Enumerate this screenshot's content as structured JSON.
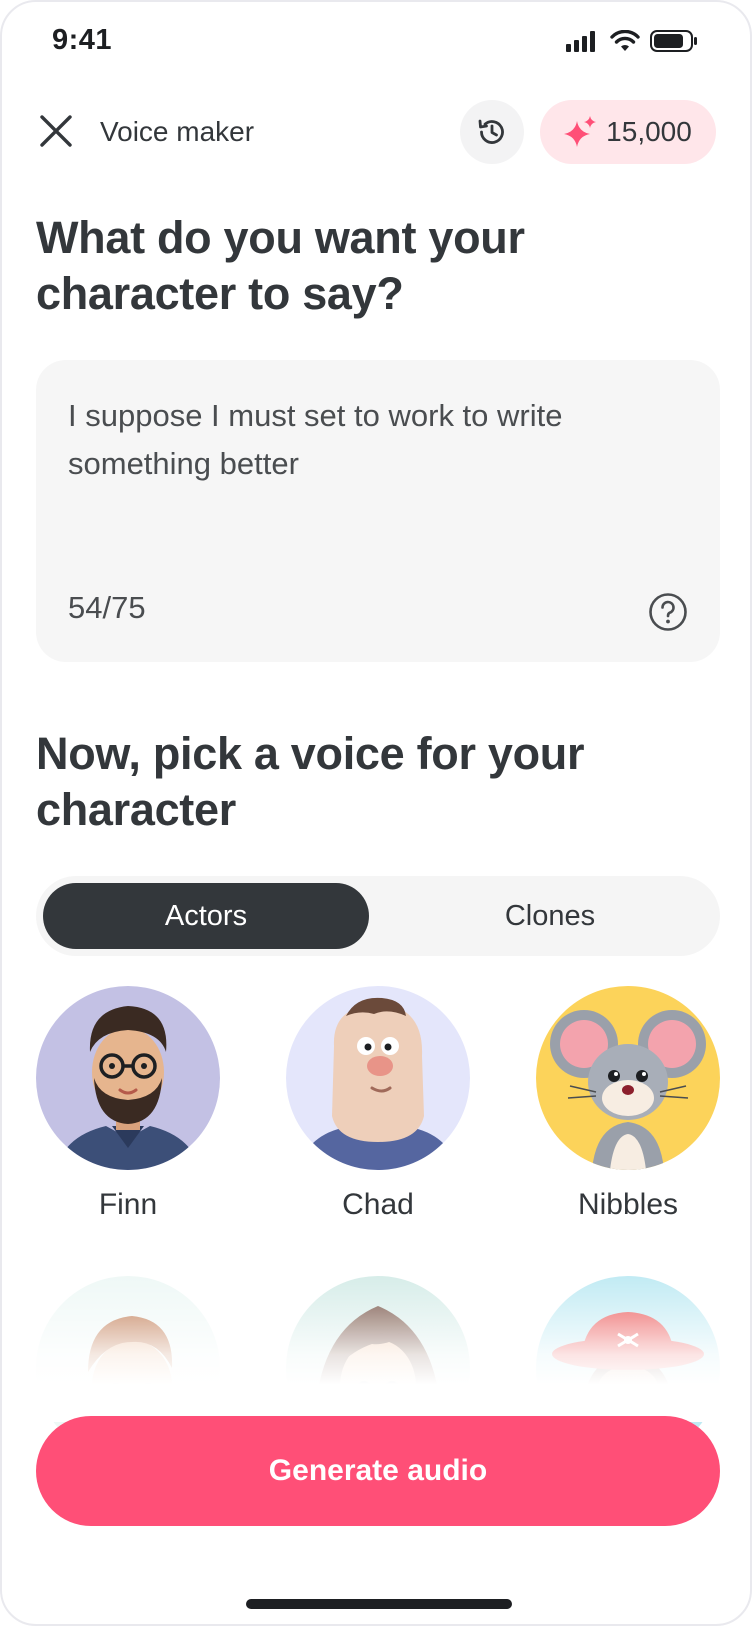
{
  "status_bar": {
    "time": "9:41"
  },
  "header": {
    "title": "Voice maker",
    "credits": "15,000"
  },
  "prompt": {
    "heading": "What do you want your character to say?",
    "text": "I suppose I must set to work to write something better",
    "count": "54/75"
  },
  "voices_section": {
    "heading": "Now, pick a voice for your character",
    "tabs": {
      "actors": "Actors",
      "clones": "Clones"
    },
    "voices": [
      {
        "name": "Finn"
      },
      {
        "name": "Chad"
      },
      {
        "name": "Nibbles"
      }
    ]
  },
  "actions": {
    "generate": "Generate audio"
  },
  "colors": {
    "accent": "#ff4f77",
    "dark": "#33373b",
    "pill_bg": "#ffe6ea"
  }
}
